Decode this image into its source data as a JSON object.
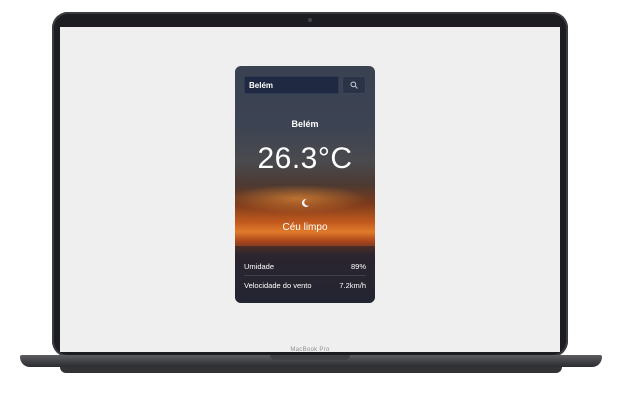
{
  "device": {
    "brand_label": "MacBook Pro"
  },
  "weather": {
    "search": {
      "value": "Belém",
      "placeholder": "",
      "button_icon": "search-icon"
    },
    "city": "Belém",
    "temperature": "26.3°C",
    "condition_icon": "moon-icon",
    "condition": "Céu limpo",
    "details": [
      {
        "label": "Umidade",
        "value": "89%"
      },
      {
        "label": "Velocidade do vento",
        "value": "7.2km/h"
      }
    ]
  }
}
